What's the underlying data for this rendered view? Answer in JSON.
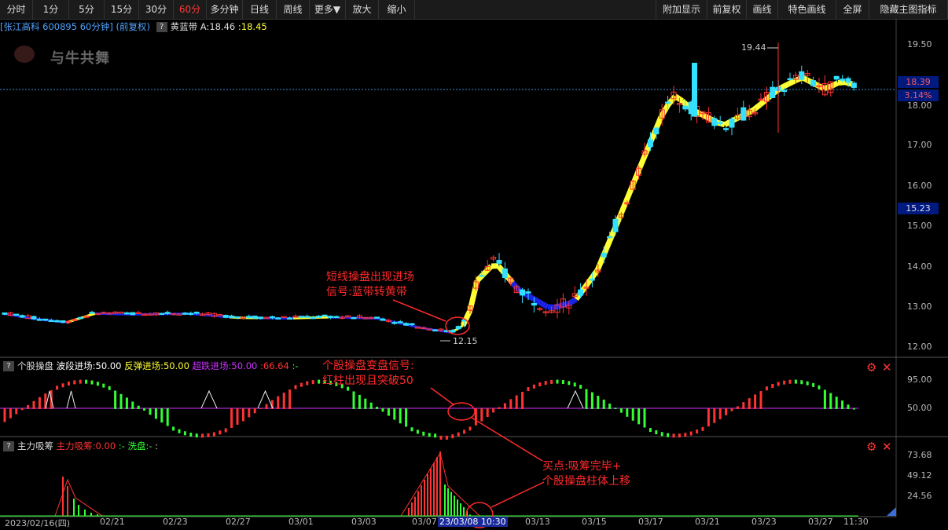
{
  "toolbar": {
    "left": [
      "分时",
      "1分",
      "5分",
      "15分",
      "30分",
      "60分",
      "多分钟",
      "日线",
      "周线",
      "更多▼",
      "放大",
      "缩小"
    ],
    "active": "60分",
    "right": [
      "附加显示",
      "前复权",
      "画线",
      "特色画线",
      "全屏",
      "隐藏主图指标"
    ]
  },
  "header": {
    "stock": "[张江高科 600895 60分钟]",
    "adj": "(前复权)",
    "indicator": "黄蓝带",
    "a_label": "A:18.46",
    "val": ":18.45"
  },
  "watermark": "与牛共舞",
  "price_axis": [
    "19.50",
    "18.00",
    "17.00",
    "16.00",
    "15.00",
    "14.00",
    "13.00",
    "12.00"
  ],
  "price_tags": {
    "last": "18.39",
    "pct": "3.14%",
    "cursor": "15.23"
  },
  "extremes": {
    "high": "19.44",
    "low": "12.15"
  },
  "sub1": {
    "name": "个股操盘",
    "l1": "波段进场:50.00",
    "l2": "反弹进场:50.00",
    "l3": "超跌进场:50.00",
    "l4": ":66.64",
    "l5": ":-",
    "axis": [
      "95.00",
      "50.00"
    ]
  },
  "sub2": {
    "name": "主力吸筹",
    "l1": "主力吸筹:0.00",
    "l2": ":-",
    "l3": "洗盘:-",
    "l4": ":",
    "axis": [
      "73.68",
      "49.12",
      "24.56"
    ]
  },
  "x_axis": [
    "2023/02/16(四)",
    "02/21",
    "02/23",
    "02/27",
    "03/01",
    "03/03",
    "03/07",
    "23/03/08 10:30",
    "03/13",
    "03/15",
    "03/17",
    "03/21",
    "03/23",
    "03/27",
    "11:30"
  ],
  "annotations": {
    "a1": [
      "短线操盘出现进场",
      "信号:蓝带转黄带"
    ],
    "a2": [
      "个股操盘变盘信号:",
      "红柱出现且突破50"
    ],
    "a3": [
      "买点:吸筹完毕+",
      "个股操盘柱体上移"
    ]
  },
  "colors": {
    "up": "#ff3333",
    "down": "#33e0ff",
    "yellow": "#ffff33",
    "blue": "#1a22e6",
    "purple": "#cc33ff",
    "green": "#33ff33",
    "ann": "#ff2a2a"
  }
}
